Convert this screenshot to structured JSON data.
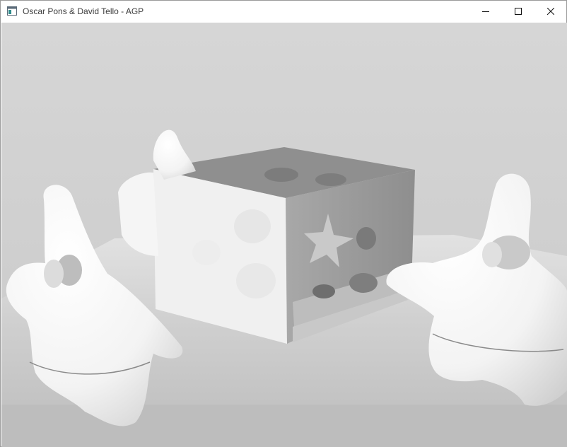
{
  "window": {
    "title": "Oscar Pons & David Tello - AGP",
    "controls": {
      "minimize": "minimize-icon",
      "maximize": "maximize-icon",
      "close": "close-icon"
    }
  },
  "scene": {
    "description_icons": [
      "box-model",
      "star-character-model"
    ],
    "colors": {
      "background_top": "#cfcfcf",
      "floor": "#bcbcbc",
      "model_light": "#f7f7f7",
      "box_shadow": "#9a9a9a"
    }
  }
}
